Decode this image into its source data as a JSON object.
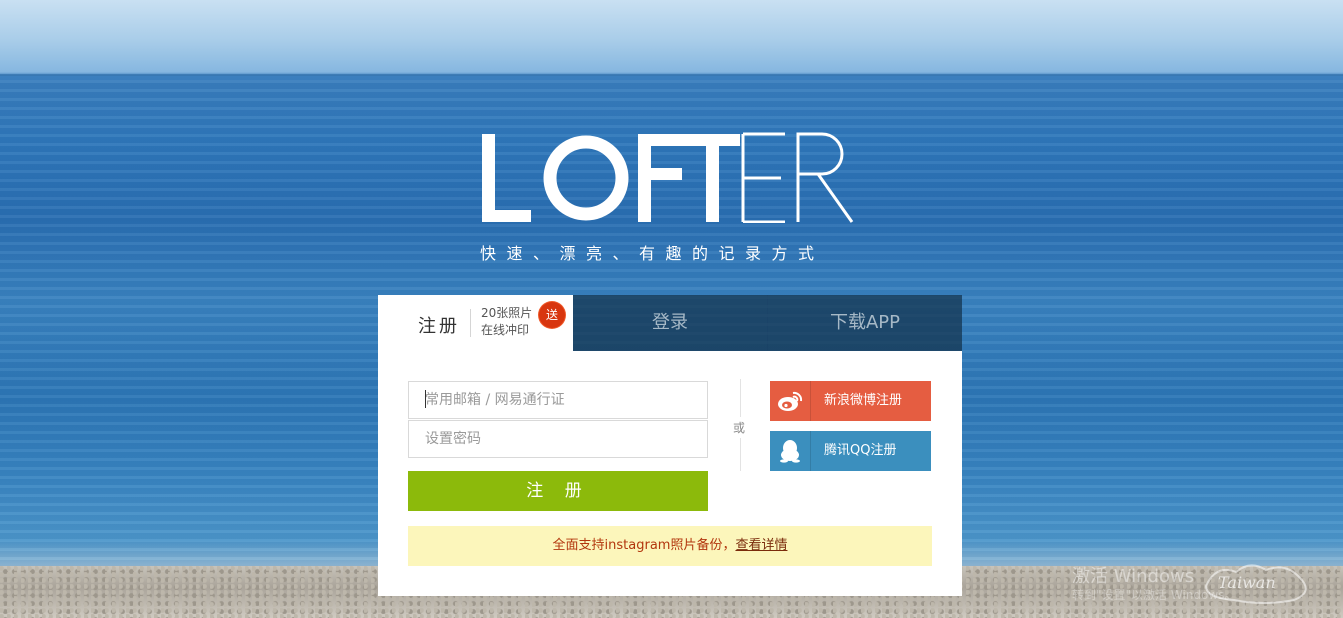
{
  "brand": {
    "logo_text": "LOFTER",
    "tagline": "快速、漂亮、有趣的记录方式"
  },
  "tabs": {
    "register_label": "注册",
    "promo_line1": "20张照片",
    "promo_line2": "在线冲印",
    "promo_badge": "送",
    "login_label": "登录",
    "app_label": "下载APP"
  },
  "form": {
    "email_placeholder": "常用邮箱 / 网易通行证",
    "password_placeholder": "设置密码",
    "submit_label": "注 册",
    "or_label": "或"
  },
  "social": {
    "weibo_label": "新浪微博注册",
    "qq_label": "腾讯QQ注册"
  },
  "notice": {
    "text": "全面支持instagram照片备份，",
    "link_label": "查看详情"
  },
  "overlay": {
    "activation_text": "激活 Windows",
    "activation_sub": "转到\"设置\"以激活 Windows。",
    "taiwan_logo_text": "Taiwan"
  },
  "colors": {
    "register_green": "#8cba0b",
    "weibo_orange": "#e55d41",
    "qq_blue": "#3b8fbe",
    "notice_bg": "#fcf6bb",
    "notice_text": "#b2360d",
    "badge_red": "#d8360f"
  },
  "icons": {
    "weibo": "weibo-icon",
    "qq": "qq-penguin-icon",
    "badge": "gift-badge"
  }
}
